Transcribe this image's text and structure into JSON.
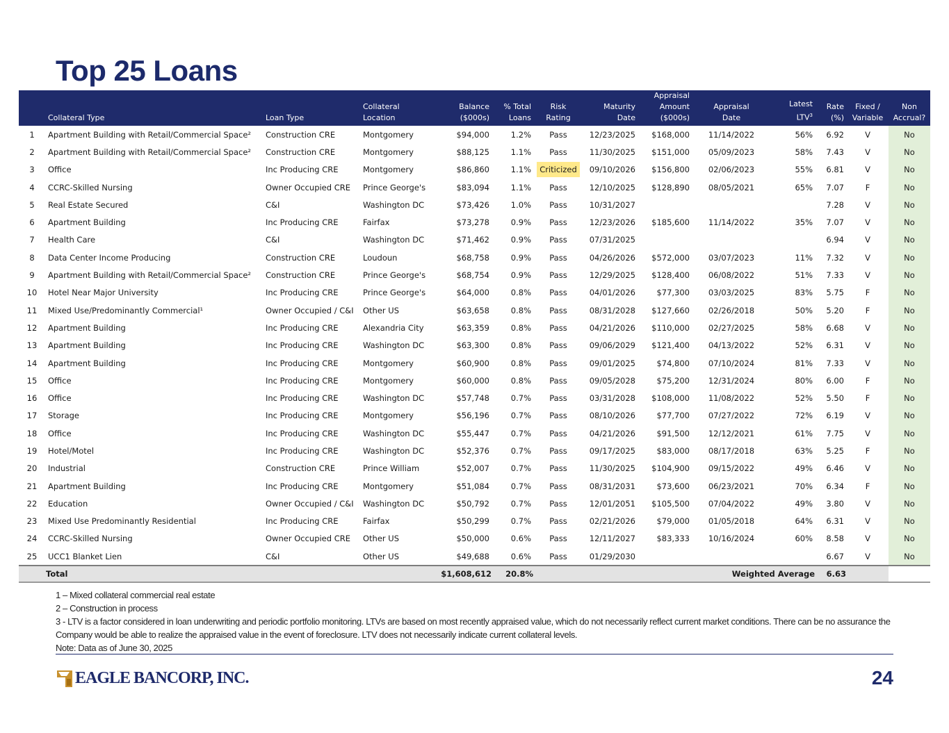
{
  "title": "Top 25 Loans",
  "headers": {
    "num": "",
    "collateral_type": "Collateral Type",
    "loan_type": "Loan Type",
    "location": [
      "Collateral",
      "Location"
    ],
    "balance": [
      "Balance",
      "($000s)"
    ],
    "pct": [
      "% Total",
      "Loans"
    ],
    "risk": [
      "Risk",
      "Rating"
    ],
    "maturity": [
      "Maturity",
      "Date"
    ],
    "appraisal_amt": [
      "Appraisal",
      "Amount",
      "($000s)"
    ],
    "appraisal_date": [
      "Appraisal",
      "Date"
    ],
    "ltv": [
      "Latest",
      "LTV",
      "3"
    ],
    "rate": [
      "Rate",
      "(%)"
    ],
    "fixed": [
      "Fixed /",
      "Variable"
    ],
    "non": [
      "Non",
      "Accrual?"
    ]
  },
  "rows": [
    [
      "1",
      "Apartment Building with Retail/Commercial Space²",
      "Construction CRE",
      "Montgomery",
      "$94,000",
      "1.2%",
      "Pass",
      "12/23/2025",
      "$168,000",
      "11/14/2022",
      "56%",
      "6.92",
      "V",
      "No"
    ],
    [
      "2",
      "Apartment Building with Retail/Commercial Space²",
      "Construction CRE",
      "Montgomery",
      "$88,125",
      "1.1%",
      "Pass",
      "11/30/2025",
      "$151,000",
      "05/09/2023",
      "58%",
      "7.43",
      "V",
      "No"
    ],
    [
      "3",
      "Office",
      "Inc Producing CRE",
      "Montgomery",
      "$86,860",
      "1.1%",
      "Criticized",
      "09/10/2026",
      "$156,800",
      "02/06/2023",
      "55%",
      "6.81",
      "V",
      "No"
    ],
    [
      "4",
      "CCRC-Skilled Nursing",
      "Owner Occupied CRE",
      "Prince George's",
      "$83,094",
      "1.1%",
      "Pass",
      "12/10/2025",
      "$128,890",
      "08/05/2021",
      "65%",
      "7.07",
      "F",
      "No"
    ],
    [
      "5",
      "Real Estate Secured",
      "C&I",
      "Washington DC",
      "$73,426",
      "1.0%",
      "Pass",
      "10/31/2027",
      "",
      "",
      "",
      "7.28",
      "V",
      "No"
    ],
    [
      "6",
      "Apartment Building",
      "Inc Producing CRE",
      "Fairfax",
      "$73,278",
      "0.9%",
      "Pass",
      "12/23/2026",
      "$185,600",
      "11/14/2022",
      "35%",
      "7.07",
      "V",
      "No"
    ],
    [
      "7",
      "Health Care",
      "C&I",
      "Washington DC",
      "$71,462",
      "0.9%",
      "Pass",
      "07/31/2025",
      "",
      "",
      "",
      "6.94",
      "V",
      "No"
    ],
    [
      "8",
      "Data Center Income Producing",
      "Construction CRE",
      "Loudoun",
      "$68,758",
      "0.9%",
      "Pass",
      "04/26/2026",
      "$572,000",
      "03/07/2023",
      "11%",
      "7.32",
      "V",
      "No"
    ],
    [
      "9",
      "Apartment Building with Retail/Commercial Space²",
      "Construction CRE",
      "Prince George's",
      "$68,754",
      "0.9%",
      "Pass",
      "12/29/2025",
      "$128,400",
      "06/08/2022",
      "51%",
      "7.33",
      "V",
      "No"
    ],
    [
      "10",
      "Hotel Near Major University",
      "Inc Producing CRE",
      "Prince George's",
      "$64,000",
      "0.8%",
      "Pass",
      "04/01/2026",
      "$77,300",
      "03/03/2025",
      "83%",
      "5.75",
      "F",
      "No"
    ],
    [
      "11",
      "Mixed Use/Predominantly Commercial¹",
      "Owner Occupied / C&I",
      "Other US",
      "$63,658",
      "0.8%",
      "Pass",
      "08/31/2028",
      "$127,660",
      "02/26/2018",
      "50%",
      "5.20",
      "F",
      "No"
    ],
    [
      "12",
      "Apartment Building",
      "Inc Producing CRE",
      "Alexandria City",
      "$63,359",
      "0.8%",
      "Pass",
      "04/21/2026",
      "$110,000",
      "02/27/2025",
      "58%",
      "6.68",
      "V",
      "No"
    ],
    [
      "13",
      "Apartment Building",
      "Inc Producing CRE",
      "Washington DC",
      "$63,300",
      "0.8%",
      "Pass",
      "09/06/2029",
      "$121,400",
      "04/13/2022",
      "52%",
      "6.31",
      "V",
      "No"
    ],
    [
      "14",
      "Apartment Building",
      "Inc Producing CRE",
      "Montgomery",
      "$60,900",
      "0.8%",
      "Pass",
      "09/01/2025",
      "$74,800",
      "07/10/2024",
      "81%",
      "7.33",
      "V",
      "No"
    ],
    [
      "15",
      "Office",
      "Inc Producing CRE",
      "Montgomery",
      "$60,000",
      "0.8%",
      "Pass",
      "09/05/2028",
      "$75,200",
      "12/31/2024",
      "80%",
      "6.00",
      "F",
      "No"
    ],
    [
      "16",
      "Office",
      "Inc Producing CRE",
      "Washington DC",
      "$57,748",
      "0.7%",
      "Pass",
      "03/31/2028",
      "$108,000",
      "11/08/2022",
      "52%",
      "5.50",
      "F",
      "No"
    ],
    [
      "17",
      "Storage",
      "Inc Producing CRE",
      "Montgomery",
      "$56,196",
      "0.7%",
      "Pass",
      "08/10/2026",
      "$77,700",
      "07/27/2022",
      "72%",
      "6.19",
      "V",
      "No"
    ],
    [
      "18",
      "Office",
      "Inc Producing CRE",
      "Washington DC",
      "$55,447",
      "0.7%",
      "Pass",
      "04/21/2026",
      "$91,500",
      "12/12/2021",
      "61%",
      "7.75",
      "V",
      "No"
    ],
    [
      "19",
      "Hotel/Motel",
      "Inc Producing CRE",
      "Washington DC",
      "$52,376",
      "0.7%",
      "Pass",
      "09/17/2025",
      "$83,000",
      "08/17/2018",
      "63%",
      "5.25",
      "F",
      "No"
    ],
    [
      "20",
      "Industrial",
      "Construction CRE",
      "Prince William",
      "$52,007",
      "0.7%",
      "Pass",
      "11/30/2025",
      "$104,900",
      "09/15/2022",
      "49%",
      "6.46",
      "V",
      "No"
    ],
    [
      "21",
      "Apartment Building",
      "Inc Producing CRE",
      "Montgomery",
      "$51,084",
      "0.7%",
      "Pass",
      "08/31/2031",
      "$73,600",
      "06/23/2021",
      "70%",
      "6.34",
      "F",
      "No"
    ],
    [
      "22",
      "Education",
      "Owner Occupied / C&I",
      "Washington DC",
      "$50,792",
      "0.7%",
      "Pass",
      "12/01/2051",
      "$105,500",
      "07/04/2022",
      "49%",
      "3.80",
      "V",
      "No"
    ],
    [
      "23",
      "Mixed Use Predominantly Residential",
      "Inc Producing CRE",
      "Fairfax",
      "$50,299",
      "0.7%",
      "Pass",
      "02/21/2026",
      "$79,000",
      "01/05/2018",
      "64%",
      "6.31",
      "V",
      "No"
    ],
    [
      "24",
      "CCRC-Skilled Nursing",
      "Owner Occupied CRE",
      "Other US",
      "$50,000",
      "0.6%",
      "Pass",
      "12/11/2027",
      "$83,333",
      "10/16/2024",
      "60%",
      "8.58",
      "V",
      "No"
    ],
    [
      "25",
      "UCC1 Blanket Lien",
      "C&I",
      "Other US",
      "$49,688",
      "0.6%",
      "Pass",
      "01/29/2030",
      "",
      "",
      "",
      "6.67",
      "V",
      "No"
    ]
  ],
  "total": {
    "label": "Total",
    "balance": "$1,608,612",
    "pct": "20.8%",
    "wa_label": "Weighted Average",
    "wa_rate": "6.63"
  },
  "notes": [
    "1 – Mixed collateral commercial real estate",
    "2 – Construction in process",
    "3 - LTV is a factor considered in loan underwriting and periodic portfolio monitoring. LTVs are based on most recently appraised value, which do not necessarily reflect current market conditions. There can be no assurance the Company would be able to realize the appraised value in the event of foreclosure. LTV does not necessarily indicate current collateral levels.",
    "Note: Data as of June 30, 2025"
  ],
  "logo_text": "EAGLE BANCORP, INC.",
  "page_number": "24",
  "colors": {
    "navy": "#1f2b6b",
    "criticized": "#ffe98a",
    "non_accrual_bg": "#e2efd9",
    "total_bg": "#e3e3e3"
  }
}
